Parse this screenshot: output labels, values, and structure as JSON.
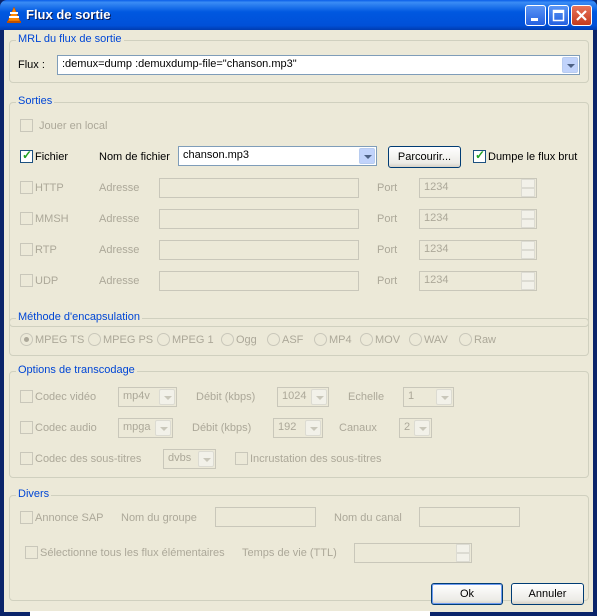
{
  "window": {
    "title": "Flux de sortie"
  },
  "mrl": {
    "group_label": "MRL du flux de sortie",
    "label": "Flux :",
    "value": ":demux=dump :demuxdump-file=\"chanson.mp3\""
  },
  "outputs": {
    "group_label": "Sorties",
    "play_local": "Jouer en local",
    "file": {
      "checkbox_label": "Fichier",
      "checked": true,
      "name_label": "Nom de fichier",
      "name_value": "chanson.mp3",
      "browse": "Parcourir...",
      "dump_label": "Dumpe le flux brut",
      "dump_checked": true
    },
    "network": [
      {
        "label": "HTTP",
        "address_label": "Adresse",
        "port_label": "Port",
        "port": "1234"
      },
      {
        "label": "MMSH",
        "address_label": "Adresse",
        "port_label": "Port",
        "port": "1234"
      },
      {
        "label": "RTP",
        "address_label": "Adresse",
        "port_label": "Port",
        "port": "1234"
      },
      {
        "label": "UDP",
        "address_label": "Adresse",
        "port_label": "Port",
        "port": "1234"
      }
    ]
  },
  "encapsulation": {
    "group_label": "Méthode d'encapsulation",
    "options": [
      "MPEG TS",
      "MPEG PS",
      "MPEG 1",
      "Ogg",
      "ASF",
      "MP4",
      "MOV",
      "WAV",
      "Raw"
    ],
    "selected": "MPEG TS"
  },
  "transcode": {
    "group_label": "Options de transcodage",
    "video": {
      "label": "Codec vidéo",
      "codec": "mp4v",
      "bitrate_label": "Débit (kbps)",
      "bitrate": "1024",
      "scale_label": "Echelle",
      "scale": "1"
    },
    "audio": {
      "label": "Codec audio",
      "codec": "mpga",
      "bitrate_label": "Débit (kbps)",
      "bitrate": "192",
      "channels_label": "Canaux",
      "channels": "2"
    },
    "subs": {
      "label": "Codec des sous-titres",
      "codec": "dvbs",
      "overlay_label": "Incrustation des sous-titres"
    }
  },
  "misc": {
    "group_label": "Divers",
    "sap_label": "Annonce SAP",
    "group_name_label": "Nom du groupe",
    "channel_name_label": "Nom du canal",
    "select_all_label": "Sélectionne tous les flux élémentaires",
    "ttl_label": "Temps de vie (TTL)"
  },
  "buttons": {
    "ok": "Ok",
    "cancel": "Annuler"
  },
  "colors": {
    "titlebar": "#0058e0",
    "group_label": "#0046d5",
    "dialog_bg": "#ece9d8",
    "check": "#21a121"
  }
}
